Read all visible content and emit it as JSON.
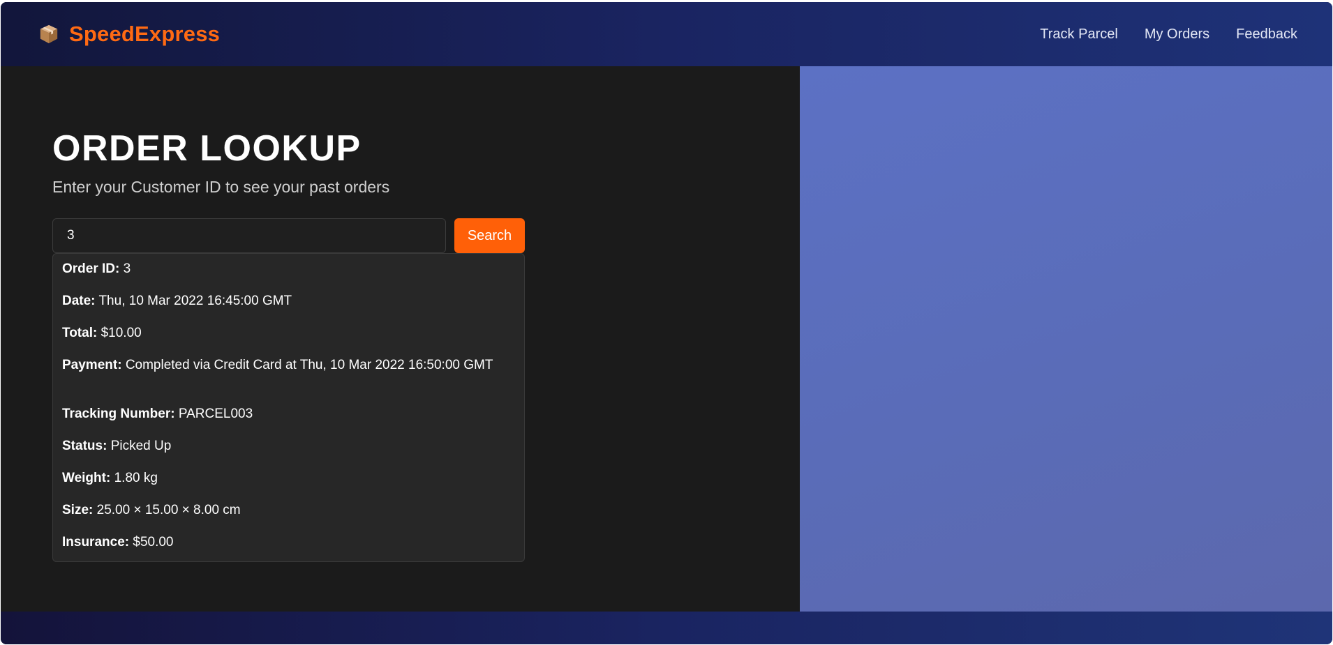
{
  "header": {
    "brand_name": "SpeedExpress",
    "brand_icon": "package-icon",
    "nav": [
      "Track Parcel",
      "My Orders",
      "Feedback"
    ]
  },
  "lookup": {
    "title": "ORDER LOOKUP",
    "subtitle": "Enter your Customer ID to see your past orders",
    "search_value": "3",
    "search_button": "Search"
  },
  "order": {
    "fields": [
      {
        "label": "Order ID:",
        "value": "3"
      },
      {
        "label": "Date:",
        "value": "Thu, 10 Mar 2022 16:45:00 GMT"
      },
      {
        "label": "Total:",
        "value": "$10.00"
      },
      {
        "label": "Payment:",
        "value": "Completed via Credit Card at Thu, 10 Mar 2022 16:50:00 GMT"
      }
    ],
    "parcel": [
      {
        "label": "Tracking Number:",
        "value": "PARCEL003"
      },
      {
        "label": "Status:",
        "value": "Picked Up"
      },
      {
        "label": "Weight:",
        "value": "1.80 kg"
      },
      {
        "label": "Size:",
        "value": "25.00 × 15.00 × 8.00 cm"
      },
      {
        "label": "Insurance:",
        "value": "$50.00"
      }
    ]
  },
  "colors": {
    "accent": "#ff6008",
    "brand": "#ff6a13",
    "header_bg": "#1a2461",
    "right_panel": "#5a6cb8"
  }
}
